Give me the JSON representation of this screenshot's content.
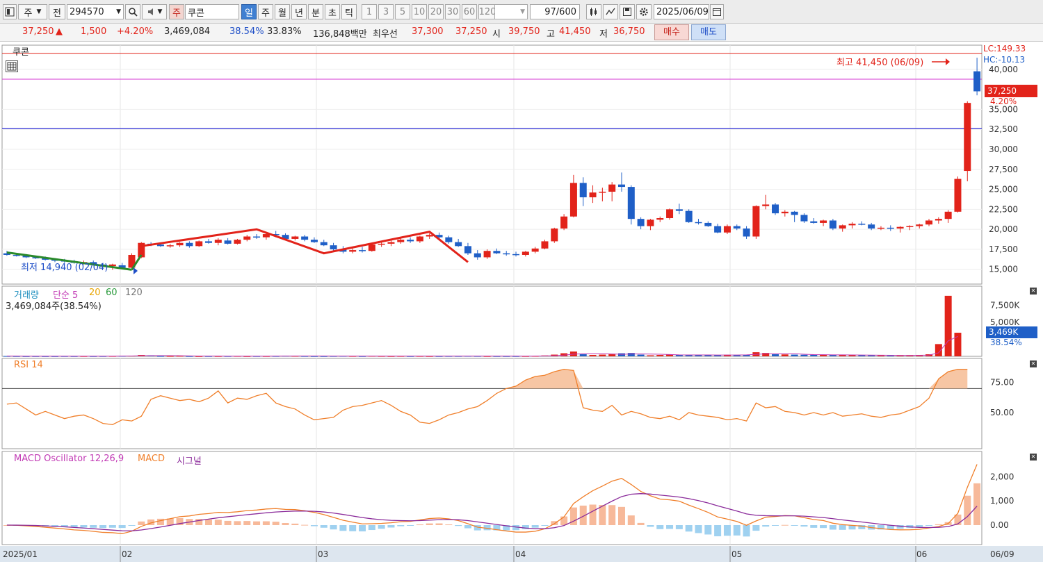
{
  "toolbar": {
    "market_label": "주",
    "prefix_label": "전",
    "code": "294570",
    "stock_type": "주",
    "stock_name": "쿠콘",
    "periods": [
      "일",
      "주",
      "월",
      "년",
      "분",
      "초",
      "틱"
    ],
    "selected_period": "일",
    "intervals": [
      "1",
      "3",
      "5",
      "10",
      "20",
      "30",
      "60",
      "120"
    ],
    "count": "97",
    "count_max": "/600",
    "date": "2025/06/09"
  },
  "quote": {
    "price": "37,250",
    "change": "1,500",
    "change_pct": "+4.20%",
    "volume": "3,469,084",
    "turnover_pct": "38.54%",
    "ratio": "33.83%",
    "amount": "136,848백만",
    "best_label": "최우선",
    "best_ask": "37,300",
    "best_bid": "37,250",
    "open_label": "시",
    "open": "39,750",
    "high_label": "고",
    "high": "41,450",
    "low_label": "저",
    "low": "36,750",
    "buy_label": "매수",
    "sell_label": "매도"
  },
  "price_panel": {
    "title": "쿠콘",
    "lc_label": "LC:149.33",
    "hc_label": "HC:-10.13",
    "high_marker": "최고 41,450 (06/09)",
    "low_marker": "최저 14,940 (02/04)",
    "current_price_box": "37,250",
    "current_pct": "4.20%",
    "y_ticks": [
      "40,000",
      "35,000",
      "32,500",
      "30,000",
      "27,500",
      "25,000",
      "22,500",
      "20,000",
      "17,500",
      "15,000"
    ]
  },
  "volume_panel": {
    "title": "거래량",
    "ma_label": "단순 5",
    "ma_20": "20",
    "ma_60": "60",
    "ma_120": "120",
    "sub": "3,469,084주(38.54%)",
    "y_ticks": [
      "7,500K",
      "5,000K"
    ],
    "current_box": "3,469K",
    "current_pct": "38.54%"
  },
  "rsi_panel": {
    "title": "RSI 14",
    "y_ticks": [
      "75.00",
      "50.00"
    ]
  },
  "macd_panel": {
    "title": "MACD Oscillator 12,26,9",
    "macd_label": "MACD",
    "signal_label": "시그널",
    "y_ticks": [
      "2,000",
      "1,000",
      "0.00"
    ]
  },
  "x_axis": [
    "2025/01",
    "02",
    "03",
    "04",
    "05",
    "06",
    "06/09"
  ],
  "colors": {
    "up": "#e2231a",
    "down": "#1f5fc7",
    "rsi": "#f07f2a",
    "macd": "#f07f2a",
    "signal": "#8a2a9a",
    "osc": "#f7b99a",
    "osc_neg": "#9fd1f0"
  },
  "chart_data": {
    "type": "candlestick",
    "candles": [
      [
        17000,
        17300,
        16700,
        16800
      ],
      [
        16800,
        17000,
        16600,
        16700
      ],
      [
        16700,
        16900,
        16400,
        16500
      ],
      [
        16500,
        16700,
        16300,
        16400
      ],
      [
        16400,
        16600,
        16100,
        16200
      ],
      [
        16200,
        16400,
        15900,
        16100
      ],
      [
        16100,
        16300,
        15800,
        16000
      ],
      [
        16000,
        16200,
        15700,
        15800
      ],
      [
        15800,
        16100,
        15600,
        15900
      ],
      [
        15900,
        16100,
        15500,
        15600
      ],
      [
        15600,
        15800,
        15300,
        15400
      ],
      [
        15400,
        15700,
        14940,
        15600
      ],
      [
        15500,
        15800,
        15000,
        15200
      ],
      [
        15200,
        17000,
        15100,
        16800
      ],
      [
        16500,
        18400,
        16400,
        18300
      ],
      [
        18200,
        18400,
        17900,
        18100
      ],
      [
        18100,
        18300,
        17800,
        17900
      ],
      [
        17900,
        18200,
        17700,
        18000
      ],
      [
        18000,
        18400,
        17800,
        18300
      ],
      [
        18300,
        18500,
        17700,
        17900
      ],
      [
        17900,
        18600,
        17800,
        18500
      ],
      [
        18500,
        18800,
        18200,
        18300
      ],
      [
        18300,
        18900,
        18000,
        18700
      ],
      [
        18600,
        18900,
        18100,
        18200
      ],
      [
        18200,
        18800,
        18100,
        18700
      ],
      [
        18700,
        19300,
        18500,
        19100
      ],
      [
        19100,
        19400,
        18800,
        19000
      ],
      [
        19000,
        19600,
        18700,
        19400
      ],
      [
        19400,
        19800,
        19000,
        19300
      ],
      [
        19300,
        19500,
        18700,
        18800
      ],
      [
        18800,
        19200,
        18600,
        19100
      ],
      [
        19100,
        19300,
        18500,
        18700
      ],
      [
        18700,
        19000,
        18300,
        18400
      ],
      [
        18400,
        18700,
        17900,
        18000
      ],
      [
        18000,
        18300,
        17300,
        17500
      ],
      [
        17500,
        17900,
        17000,
        17200
      ],
      [
        17200,
        17600,
        17000,
        17400
      ],
      [
        17400,
        17800,
        17100,
        17300
      ],
      [
        17300,
        18200,
        17200,
        18100
      ],
      [
        18100,
        18500,
        17800,
        18200
      ],
      [
        18200,
        18700,
        17900,
        18400
      ],
      [
        18400,
        18900,
        18200,
        18700
      ],
      [
        18700,
        19000,
        18300,
        18500
      ],
      [
        18500,
        19200,
        18300,
        19100
      ],
      [
        19100,
        19500,
        18800,
        19300
      ],
      [
        19300,
        19600,
        18800,
        19000
      ],
      [
        19000,
        19200,
        18200,
        18400
      ],
      [
        18400,
        18800,
        17800,
        17900
      ],
      [
        17900,
        18300,
        16800,
        17000
      ],
      [
        17000,
        17400,
        16200,
        16500
      ],
      [
        16500,
        17500,
        16300,
        17300
      ],
      [
        17300,
        17600,
        16900,
        17000
      ],
      [
        17000,
        17300,
        16700,
        16900
      ],
      [
        16900,
        17200,
        16600,
        16800
      ],
      [
        16800,
        17300,
        16600,
        17200
      ],
      [
        17200,
        17800,
        17000,
        17600
      ],
      [
        17600,
        18700,
        17500,
        18500
      ],
      [
        18500,
        20200,
        18300,
        20100
      ],
      [
        20100,
        21900,
        19900,
        21600
      ],
      [
        21600,
        26800,
        21500,
        25800
      ],
      [
        25800,
        26500,
        22900,
        24000
      ],
      [
        24000,
        25500,
        23300,
        24600
      ],
      [
        24600,
        25200,
        23500,
        24700
      ],
      [
        24700,
        25900,
        23500,
        25600
      ],
      [
        25600,
        27100,
        24700,
        25300
      ],
      [
        25300,
        25500,
        20600,
        21300
      ],
      [
        21300,
        21500,
        20000,
        20400
      ],
      [
        20400,
        21300,
        19900,
        21200
      ],
      [
        21200,
        21600,
        20900,
        21400
      ],
      [
        21400,
        22600,
        21200,
        22500
      ],
      [
        22500,
        23200,
        21900,
        22300
      ],
      [
        22300,
        22500,
        20800,
        20900
      ],
      [
        20900,
        21300,
        20600,
        20800
      ],
      [
        20800,
        21000,
        20300,
        20400
      ],
      [
        20400,
        20700,
        19500,
        19600
      ],
      [
        19600,
        20600,
        19400,
        20400
      ],
      [
        20400,
        20600,
        19900,
        20100
      ],
      [
        20100,
        20400,
        18800,
        19100
      ],
      [
        19100,
        23000,
        18800,
        22900
      ],
      [
        22900,
        24300,
        22500,
        23100
      ],
      [
        23100,
        23300,
        21800,
        22000
      ],
      [
        22000,
        22400,
        21600,
        22200
      ],
      [
        22200,
        22300,
        20900,
        21800
      ],
      [
        21800,
        22000,
        20800,
        21000
      ],
      [
        21000,
        21400,
        20700,
        20800
      ],
      [
        20800,
        21200,
        20400,
        21100
      ],
      [
        21100,
        21300,
        19900,
        20100
      ],
      [
        20100,
        20600,
        19700,
        20500
      ],
      [
        20500,
        20900,
        20100,
        20700
      ],
      [
        20700,
        21000,
        20500,
        20600
      ],
      [
        20600,
        20800,
        19900,
        20100
      ],
      [
        20100,
        20400,
        19900,
        20200
      ],
      [
        20200,
        20500,
        19800,
        20100
      ],
      [
        20100,
        20400,
        19600,
        20300
      ],
      [
        20300,
        20500,
        19900,
        20400
      ],
      [
        20400,
        20700,
        20100,
        20600
      ],
      [
        20600,
        21300,
        20400,
        21100
      ],
      [
        21100,
        21500,
        20700,
        21300
      ],
      [
        21300,
        22400,
        20800,
        22200
      ],
      [
        22200,
        26600,
        22100,
        26300
      ],
      [
        27300,
        36000,
        26000,
        35800
      ],
      [
        39750,
        41450,
        36750,
        37250
      ]
    ],
    "volumes": [
      40,
      30,
      20,
      25,
      20,
      20,
      30,
      25,
      30,
      25,
      30,
      40,
      60,
      90,
      200,
      130,
      40,
      40,
      60,
      30,
      20,
      30,
      30,
      30,
      40,
      20,
      30,
      30,
      40,
      80,
      60,
      40,
      30,
      30,
      40,
      50,
      40,
      30,
      60,
      40,
      30,
      40,
      30,
      40,
      30,
      30,
      40,
      40,
      50,
      40,
      30,
      30,
      30,
      30,
      30,
      50,
      130,
      250,
      450,
      700,
      300,
      200,
      250,
      300,
      450,
      500,
      250,
      150,
      200,
      260,
      250,
      180,
      160,
      170,
      190,
      230,
      220,
      250,
      600,
      500,
      300,
      280,
      250,
      230,
      220,
      210,
      200,
      220,
      180,
      160,
      150,
      150,
      130,
      140,
      150,
      180,
      300,
      1800,
      8900,
      3469
    ],
    "rsi": [
      57,
      58,
      53,
      48,
      51,
      48,
      45,
      47,
      48,
      45,
      41,
      40,
      44,
      43,
      47,
      61,
      64,
      62,
      60,
      61,
      59,
      62,
      68,
      58,
      62,
      61,
      64,
      66,
      58,
      55,
      53,
      48,
      44,
      45,
      46,
      52,
      55,
      56,
      58,
      60,
      56,
      51,
      48,
      42,
      41,
      44,
      48,
      50,
      53,
      55,
      60,
      66,
      70,
      72,
      77,
      80,
      81,
      84,
      86,
      85,
      54,
      52,
      51,
      56,
      48,
      51,
      49,
      46,
      45,
      47,
      44,
      50,
      48,
      47,
      46,
      44,
      45,
      43,
      58,
      54,
      55,
      51,
      50,
      48,
      50,
      48,
      50,
      47,
      48,
      49,
      47,
      46,
      48,
      49,
      52,
      55,
      62,
      78,
      84,
      86,
      86
    ],
    "ylim": [
      13500,
      42500
    ]
  }
}
